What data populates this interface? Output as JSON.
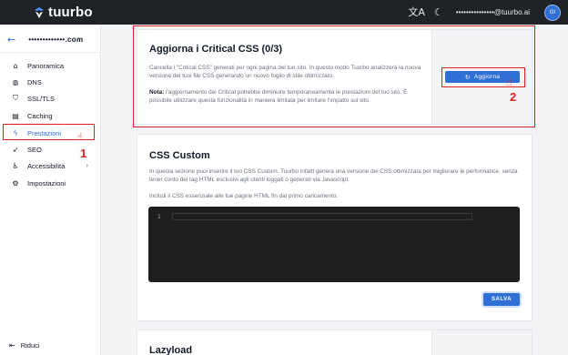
{
  "app": {
    "logo_text": "tuurbo"
  },
  "topbar": {
    "translate_icon": "translate-icon",
    "theme_icon": "moon-icon",
    "email": "•••••••••••••••@tuurbo.ai",
    "avatar_initials": "GI"
  },
  "sidebar": {
    "domain": "•••••••••••••.com",
    "items": [
      {
        "label": "Panoramica",
        "icon": "home-icon",
        "glyph": "⌂"
      },
      {
        "label": "DNS",
        "icon": "globe-icon",
        "glyph": "◍"
      },
      {
        "label": "SSL/TLS",
        "icon": "shield-icon",
        "glyph": "⛉"
      },
      {
        "label": "Caching",
        "icon": "server-icon",
        "glyph": "▤"
      },
      {
        "label": "Prestazioni",
        "icon": "bolt-icon",
        "glyph": "ϟ"
      },
      {
        "label": "SEO",
        "icon": "rocket-icon",
        "glyph": "➶"
      },
      {
        "label": "Accessibilità",
        "icon": "accessibility-icon",
        "glyph": "♿"
      },
      {
        "label": "Impostazioni",
        "icon": "gear-icon",
        "glyph": "⚙"
      }
    ],
    "reduce_label": "Riduci"
  },
  "critical": {
    "title": "Aggiorna i Critical CSS (0/3)",
    "description": "Cancella i \"Critical CSS\" generati per ogni pagina del tuo sito. In questo modo Tuurbo analizzerà la nuova versione dei tuoi file CSS generando un nuovo foglio di stile ottimizzato.",
    "note_label": "Nota:",
    "note_text": " l'aggiornamento dei Critical potrebbe diminuire temporaneamente le prestazioni del tuo sito. È possibile utilizzare questa funzionalità in maniera limitata per limitare l'impatto sul sito.",
    "button_label": "Aggiorna"
  },
  "custom_css": {
    "title": "CSS Custom",
    "description": "In questa sezione puoi inserire il tuo CSS Custom. Tuurbo infatti genera una versione dei CSS ottimizzata per migliorare le performance, senza tener conto dei tag HTML esclusivi agli utenti loggati o generati via Javascript.",
    "hint": "Includi il CSS essenziale alle tue pagine HTML fin dal primo caricamento.",
    "line_number": "1",
    "save_label": "SALVA"
  },
  "lazyload": {
    "title": "Lazyload"
  },
  "annotations": {
    "step1": "1",
    "step2": "2"
  },
  "colors": {
    "accent": "#2f6fd6",
    "annotation": "#e02020",
    "topbar": "#1f2226"
  }
}
